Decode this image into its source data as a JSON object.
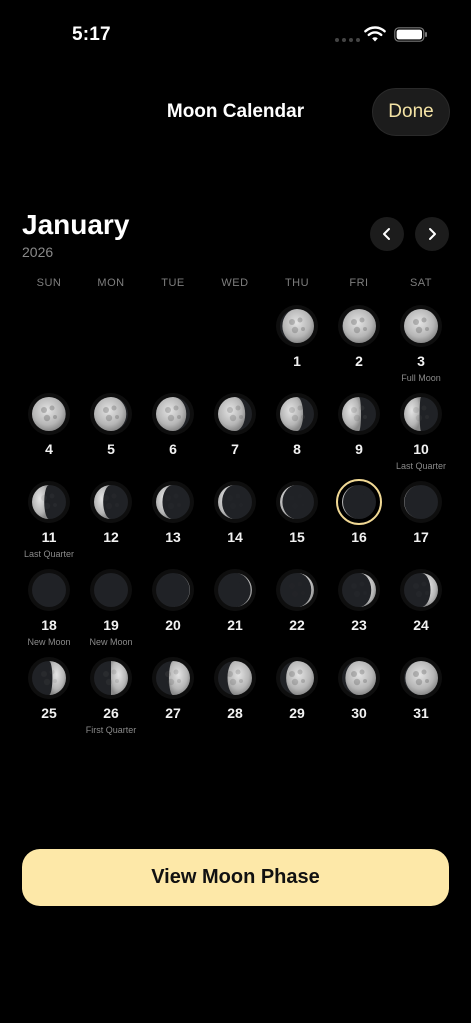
{
  "status_bar": {
    "time": "5:17"
  },
  "nav": {
    "title": "Moon Calendar",
    "done_label": "Done"
  },
  "calendar": {
    "month": "January",
    "year": "2026",
    "weekdays": [
      "SUN",
      "MON",
      "TUE",
      "WED",
      "THU",
      "FRI",
      "SAT"
    ],
    "first_weekday_index": 4,
    "selected_day": 16,
    "accent_color": "#f0d894",
    "days": [
      {
        "day": "1",
        "illum": 0.93,
        "waxing": true,
        "label": ""
      },
      {
        "day": "2",
        "illum": 0.98,
        "waxing": true,
        "label": ""
      },
      {
        "day": "3",
        "illum": 1.0,
        "waxing": true,
        "label": "Full Moon"
      },
      {
        "day": "4",
        "illum": 0.99,
        "waxing": false,
        "label": ""
      },
      {
        "day": "5",
        "illum": 0.95,
        "waxing": false,
        "label": ""
      },
      {
        "day": "6",
        "illum": 0.89,
        "waxing": false,
        "label": ""
      },
      {
        "day": "7",
        "illum": 0.8,
        "waxing": false,
        "label": ""
      },
      {
        "day": "8",
        "illum": 0.68,
        "waxing": false,
        "label": ""
      },
      {
        "day": "9",
        "illum": 0.56,
        "waxing": false,
        "label": ""
      },
      {
        "day": "10",
        "illum": 0.46,
        "waxing": false,
        "label": "Last Quarter"
      },
      {
        "day": "11",
        "illum": 0.36,
        "waxing": false,
        "label": "Last Quarter"
      },
      {
        "day": "12",
        "illum": 0.27,
        "waxing": false,
        "label": ""
      },
      {
        "day": "13",
        "illum": 0.19,
        "waxing": false,
        "label": ""
      },
      {
        "day": "14",
        "illum": 0.12,
        "waxing": false,
        "label": ""
      },
      {
        "day": "15",
        "illum": 0.07,
        "waxing": false,
        "label": ""
      },
      {
        "day": "16",
        "illum": 0.03,
        "waxing": false,
        "label": ""
      },
      {
        "day": "17",
        "illum": 0.01,
        "waxing": false,
        "label": ""
      },
      {
        "day": "18",
        "illum": 0.0,
        "waxing": true,
        "label": "New Moon"
      },
      {
        "day": "19",
        "illum": 0.0,
        "waxing": true,
        "label": "New Moon"
      },
      {
        "day": "20",
        "illum": 0.01,
        "waxing": true,
        "label": ""
      },
      {
        "day": "21",
        "illum": 0.04,
        "waxing": true,
        "label": ""
      },
      {
        "day": "22",
        "illum": 0.08,
        "waxing": true,
        "label": ""
      },
      {
        "day": "23",
        "illum": 0.14,
        "waxing": true,
        "label": ""
      },
      {
        "day": "24",
        "illum": 0.22,
        "waxing": true,
        "label": ""
      },
      {
        "day": "25",
        "illum": 0.4,
        "waxing": true,
        "label": ""
      },
      {
        "day": "26",
        "illum": 0.5,
        "waxing": true,
        "label": "First Quarter"
      },
      {
        "day": "27",
        "illum": 0.62,
        "waxing": true,
        "label": ""
      },
      {
        "day": "28",
        "illum": 0.72,
        "waxing": true,
        "label": ""
      },
      {
        "day": "29",
        "illum": 0.82,
        "waxing": true,
        "label": ""
      },
      {
        "day": "30",
        "illum": 0.9,
        "waxing": true,
        "label": ""
      },
      {
        "day": "31",
        "illum": 0.96,
        "waxing": true,
        "label": ""
      }
    ]
  },
  "primary_action": {
    "label": "View Moon Phase",
    "color": "#fde8a8"
  }
}
